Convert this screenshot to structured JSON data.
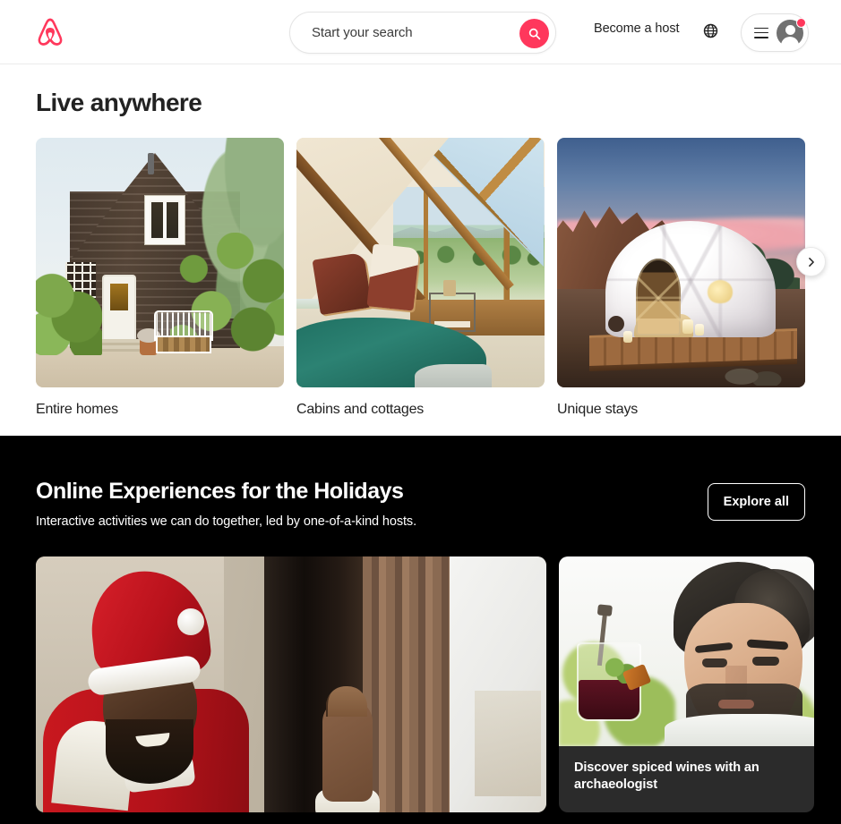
{
  "header": {
    "logo_icon": "airbnb-belo-logo",
    "logo_color": "#ff385c",
    "search": {
      "placeholder": "Start your search",
      "value": "",
      "button_icon": "search-icon",
      "button_color": "#ff375c"
    },
    "become_host_label": "Become a host",
    "globe_icon": "globe-icon",
    "menu_icon": "hamburger-menu-icon",
    "avatar_icon": "user-avatar-icon",
    "notification_badge": {
      "visible": true,
      "color": "#ff385c"
    }
  },
  "live_anywhere": {
    "title": "Live anywhere",
    "cards": [
      {
        "label": "Entire homes",
        "image_alt": "brown wooden cottage with white door and green bushes"
      },
      {
        "label": "Cabins and cottages",
        "image_alt": "A-frame cabin interior with large windows overlooking green fields"
      },
      {
        "label": "Unique stays",
        "image_alt": "geodesic dome tent on wooden deck at sunset in the desert"
      }
    ],
    "next_button_icon": "chevron-right-icon"
  },
  "online_experiences": {
    "background_color": "#000000",
    "title": "Online Experiences for the Holidays",
    "subtitle": "Interactive activities we can do together, led by one-of-a-kind hosts.",
    "explore_all_label": "Explore all",
    "cards": [
      {
        "caption": "",
        "image_alt": "person in a Santa costume waving by a window"
      },
      {
        "caption": "Discover spiced wines with an archaeologist",
        "image_alt": "bearded man holding a glass of dark red spiced wine outdoors",
        "caption_background": "#2b2b2b"
      }
    ]
  }
}
